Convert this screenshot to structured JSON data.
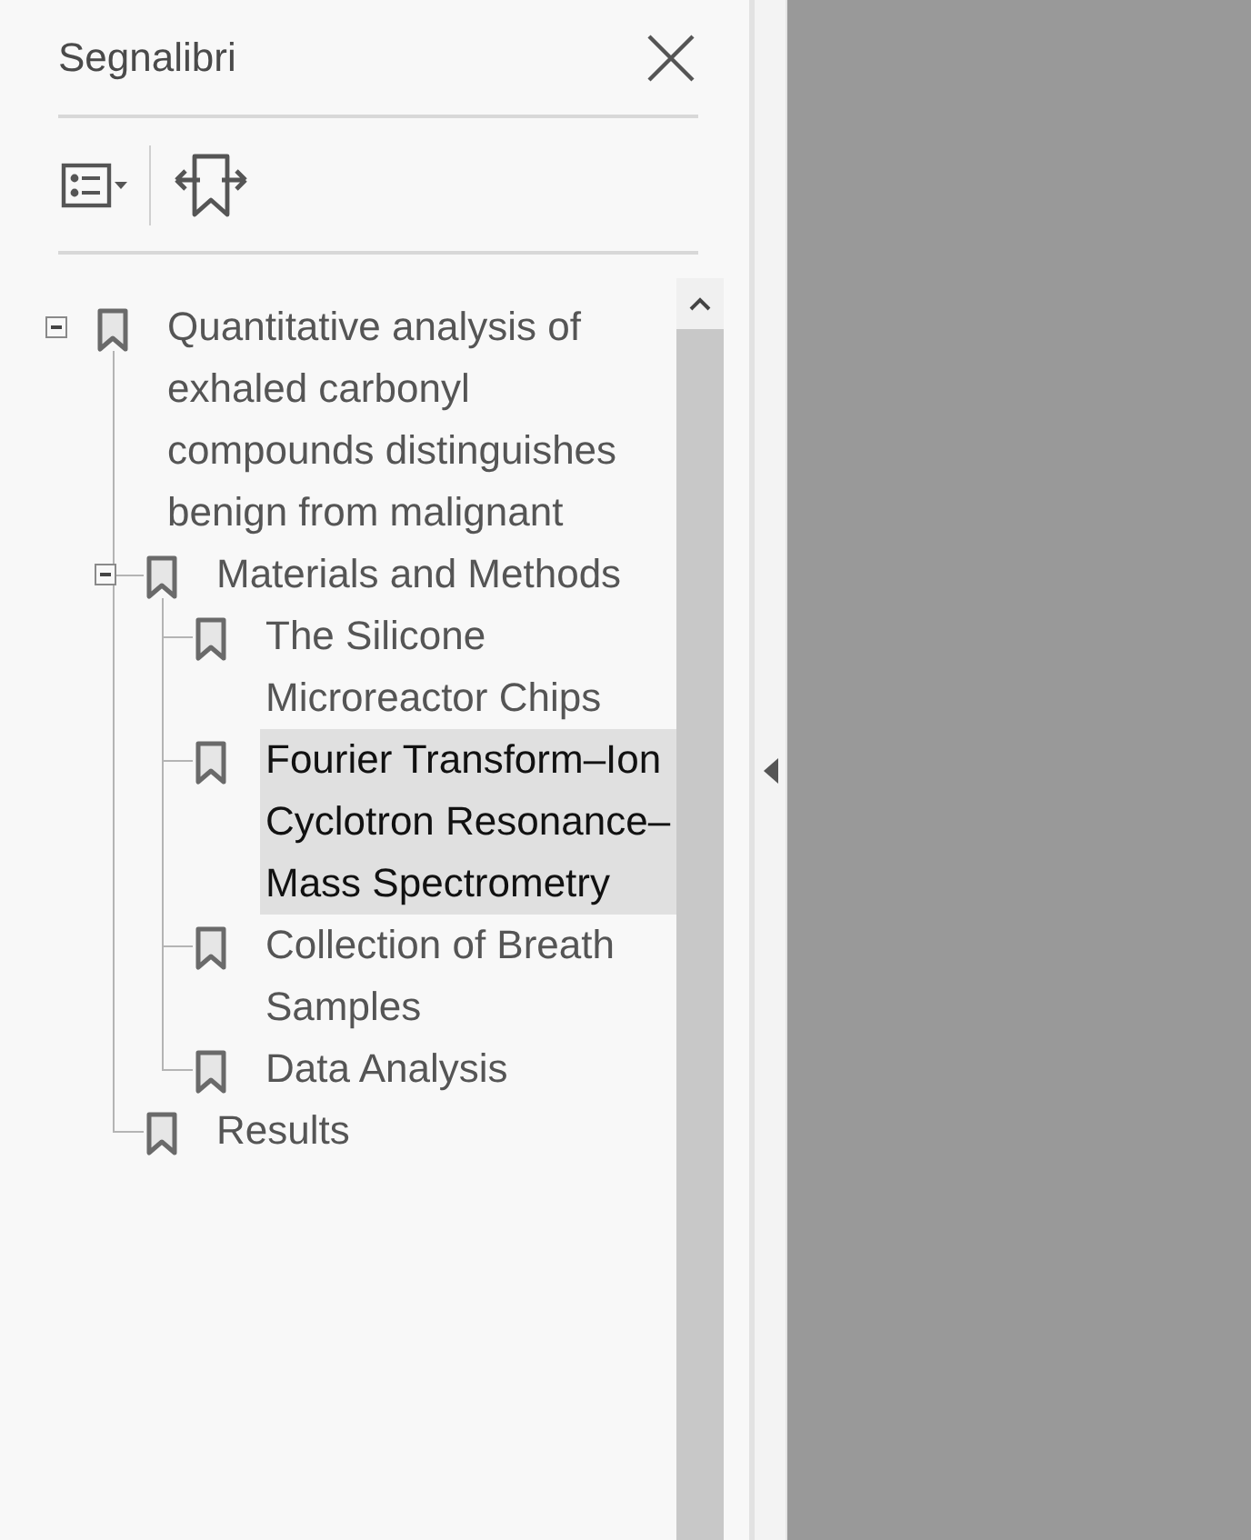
{
  "panel": {
    "title": "Segnalibri"
  },
  "bookmarks": [
    {
      "label": "Quantitative analysis of exhaled carbonyl compounds distinguishes benign from malignant",
      "expanded": true,
      "selected": false,
      "children": [
        {
          "label": "Materials and Methods",
          "expanded": true,
          "selected": false,
          "children": [
            {
              "label": "The Silicone Microreactor Chips",
              "selected": false
            },
            {
              "label": "Fourier Transform–Ion Cyclotron Resonance–Mass Spectrometry",
              "selected": true
            },
            {
              "label": "Collection of Breath Samples",
              "selected": false
            },
            {
              "label": "Data Analysis",
              "selected": false
            }
          ]
        },
        {
          "label": "Results",
          "selected": false
        }
      ]
    }
  ]
}
